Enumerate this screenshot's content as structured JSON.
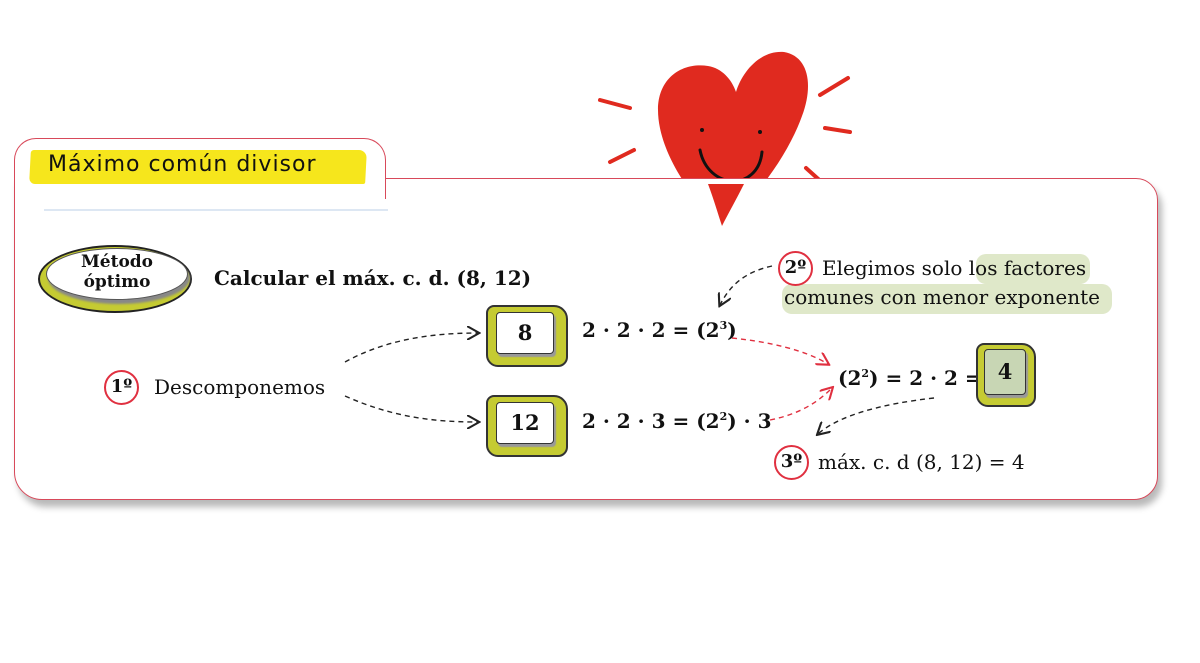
{
  "title": "Máximo común divisor",
  "method_badge": {
    "line1": "Método",
    "line2": "óptimo"
  },
  "task": "Calcular el máx. c. d. (8, 12)",
  "steps": {
    "step1": {
      "marker": "1º",
      "label": "Descomponemos"
    },
    "step2": {
      "marker": "2º",
      "line1": "Elegimos solo los factores",
      "line2": "comunes con menor exponente"
    },
    "step3": {
      "marker": "3º",
      "result": "máx. c. d (8, 12) = 4"
    }
  },
  "numbers": {
    "a": "8",
    "b": "12",
    "result": "4"
  },
  "factorizations": {
    "a_prefix": "2 · 2 · 2 = (2",
    "a_exp": "3",
    "a_suffix": ")",
    "b_prefix": "2 · 2 · 3 = (2",
    "b_exp": "2",
    "b_suffix": ") · 3",
    "c_prefix": "(2",
    "c_exp": "2",
    "c_suffix": ") = 2 · 2 ="
  },
  "colors": {
    "accent_red": "#e03040",
    "heart_red": "#e02a1f",
    "title_yellow": "#f6e61c",
    "box_olive": "#c5cb32",
    "highlight_green": "#dfe8c9"
  },
  "icons": {
    "decoration": "smiling-heart-icon"
  }
}
